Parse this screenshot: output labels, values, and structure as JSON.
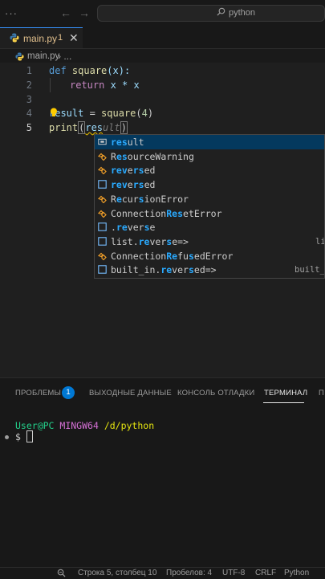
{
  "titlebar": {
    "dots": "···",
    "back": "←",
    "forward": "→",
    "search_text": "python"
  },
  "tab": {
    "filename": "main.py",
    "problem_count": "1",
    "close": "✕"
  },
  "breadcrumb": {
    "file": "main.py",
    "sep": "›",
    "more": "..."
  },
  "editor": {
    "line_numbers": [
      "1",
      "2",
      "3",
      "4",
      "5"
    ],
    "line1": {
      "kw": "def",
      "name": "square",
      "params": "(x):"
    },
    "line2": {
      "kw": "return",
      "expr": "x * x"
    },
    "line4": {
      "var": "result",
      "op": " = ",
      "call": "square",
      "arg_open": "(",
      "num": "4",
      "arg_close": ")"
    },
    "line5": {
      "call": "print",
      "open": "(",
      "typed": "res",
      "ghost": "ult",
      "close": ")"
    }
  },
  "suggest": {
    "items": [
      {
        "match": "res",
        "rest": "ult",
        "kind": "variable",
        "detail": ""
      },
      {
        "parts": [
          "R",
          "es",
          "ourceWarning"
        ],
        "kind": "class",
        "detail": ""
      },
      {
        "parts": [
          "",
          "re",
          "",
          "v",
          "e",
          "r",
          "",
          "s",
          "ed"
        ],
        "kind": "class",
        "detail": ""
      },
      {
        "parts": [
          "",
          "re",
          "",
          "v",
          "e",
          "r",
          "",
          "s",
          "ed"
        ],
        "kind": "function",
        "detail": ""
      },
      {
        "parts": [
          "R",
          "e",
          "cur",
          "s",
          "ionError"
        ],
        "kind": "class",
        "detail": ""
      },
      {
        "parts": [
          "Connection",
          "Res",
          "etError"
        ],
        "kind": "class",
        "detail": ""
      },
      {
        "parts": [
          ".",
          "re",
          "ver",
          "s",
          "e"
        ],
        "kind": "function",
        "detail": ""
      },
      {
        "parts": [
          "list.",
          "re",
          "ver",
          "s",
          "e=>"
        ],
        "kind": "function",
        "detail": "li"
      },
      {
        "parts": [
          "Connection",
          "Re",
          "fu",
          "s",
          "edError"
        ],
        "kind": "class",
        "detail": ""
      },
      {
        "parts": [
          "built_in.",
          "re",
          "ver",
          "s",
          "ed=>"
        ],
        "kind": "function",
        "detail": "built_i"
      }
    ]
  },
  "panel": {
    "tabs": [
      "ПРОБЛЕМЫ",
      "ВЫХОДНЫЕ ДАННЫЕ",
      "КОНСОЛЬ ОТЛАДКИ",
      "ТЕРМИНАЛ",
      "П"
    ],
    "problems_badge": "1",
    "terminal": {
      "user": "User@PC",
      "host": "MINGW64",
      "path": "/d/python",
      "prompt": "$"
    }
  },
  "statusbar": {
    "position": "Строка 5, столбец 10",
    "spaces": "Пробелов: 4",
    "encoding": "UTF-8",
    "eol": "CRLF",
    "language": "Python"
  },
  "colors": {
    "accent": "#0078d4",
    "match": "#2aaaff",
    "selection": "#04395e"
  }
}
